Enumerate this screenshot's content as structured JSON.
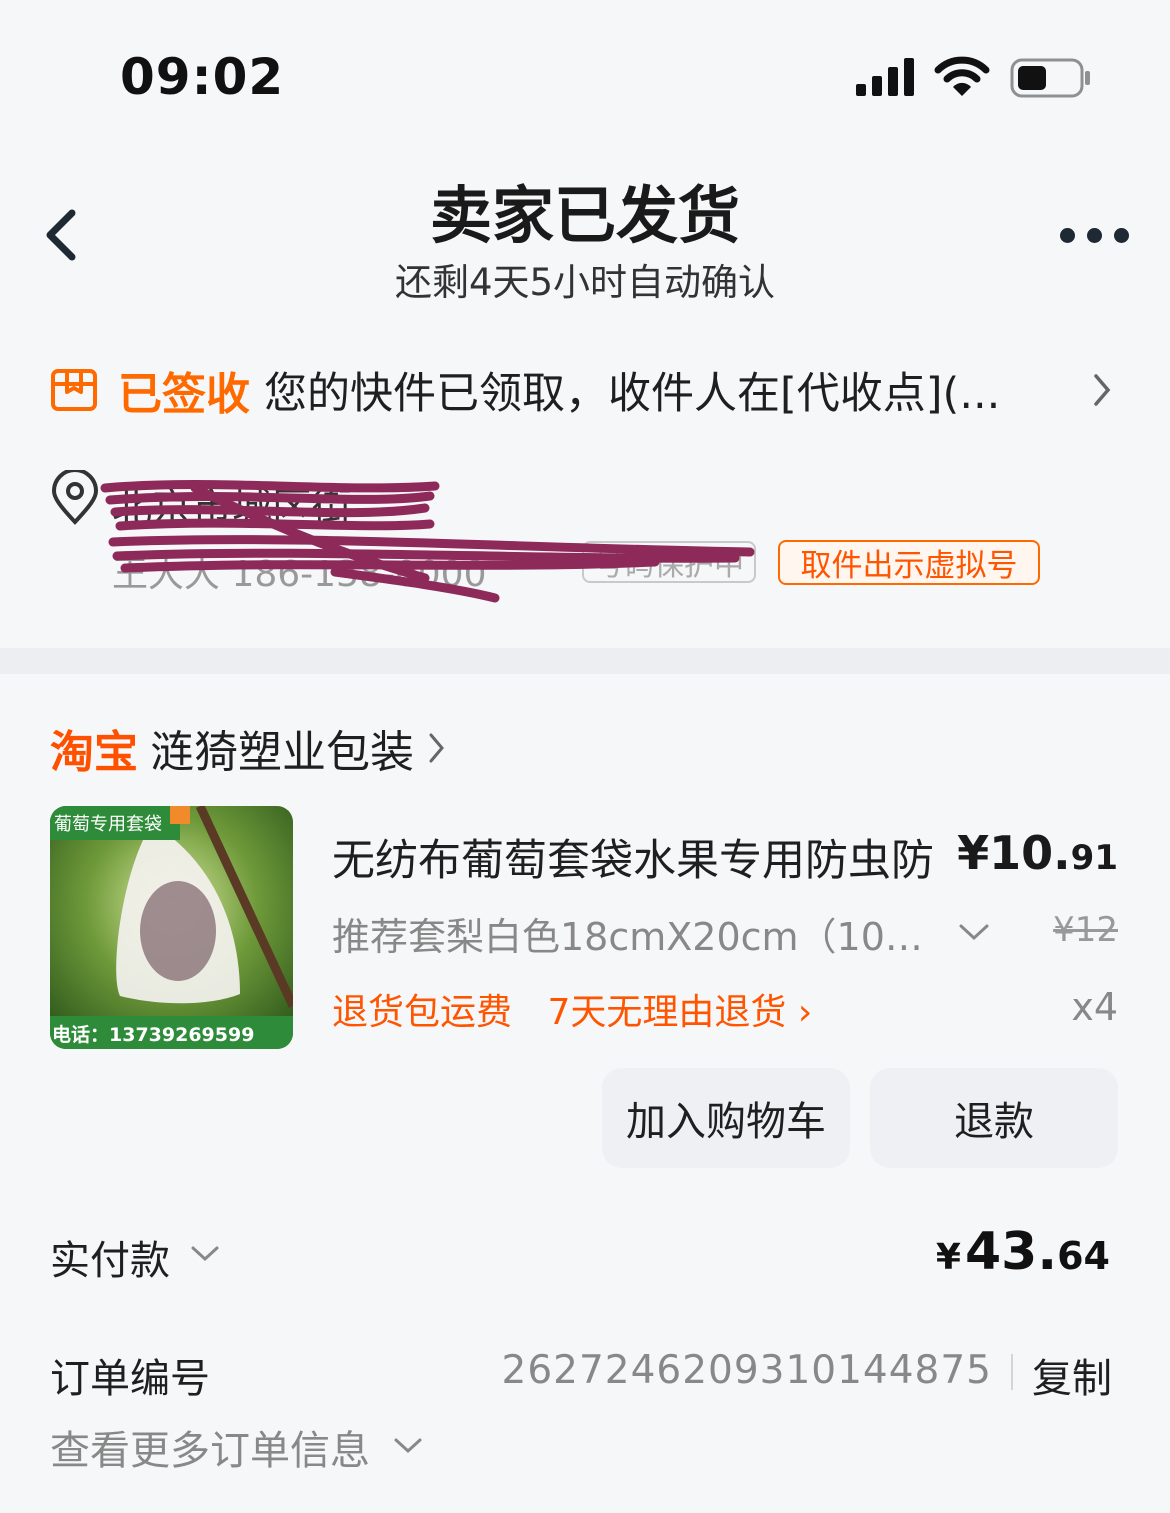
{
  "status_bar": {
    "time": "09:02"
  },
  "header": {
    "title": "卖家已发货",
    "subtitle": "还剩4天5小时自动确认"
  },
  "logistics": {
    "status": "已签收",
    "message": "您的快件已领取，收件人在[代收点](...",
    "address": "北京市城区街",
    "contact": "王大大 186-138-0000",
    "protect_badge": "号码保护中",
    "pickup_button": "取件出示虚拟号"
  },
  "shop": {
    "platform_logo": "淘宝",
    "name": "涟猗塑业包装"
  },
  "product": {
    "image_banner": "葡萄专用套袋",
    "image_phone": "电话：13739269599",
    "title": "无纺布葡萄套袋水果专用防虫防",
    "price_currency": "¥",
    "price_int": "10.",
    "price_cents": "91",
    "sku": "推荐套梨白色18cmX20cm（10…",
    "original_price": "¥12",
    "tag_shipping": "退货包运费",
    "tag_return": "7天无理由退货 ›",
    "quantity": "x4",
    "add_to_cart": "加入购物车",
    "refund": "退款"
  },
  "payment": {
    "label": "实付款",
    "currency": "¥",
    "amount_int": "43.",
    "amount_cents": "64"
  },
  "order": {
    "label": "订单编号",
    "number": "2627246209310144875",
    "copy": "复制",
    "more": "查看更多订单信息"
  },
  "colors": {
    "accent_orange": "#ff6a00",
    "text_primary": "#1f1f1f",
    "text_secondary": "#888888",
    "button_bg": "#eef0f3",
    "page_bg": "#f6f7f9",
    "redaction": "#8e2a5a"
  },
  "icons": [
    "signal-icon",
    "wifi-icon",
    "battery-icon",
    "back-icon",
    "more-icon",
    "package-icon",
    "location-pin-icon",
    "chevron-right-icon",
    "chevron-down-icon"
  ]
}
